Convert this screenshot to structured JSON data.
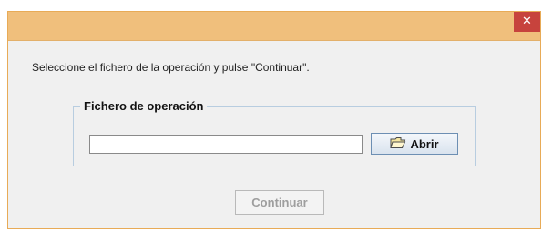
{
  "window": {
    "close_label": "✕"
  },
  "dialog": {
    "instruction": "Seleccione el fichero de la operación y pulse \"Continuar\".",
    "group_title": "Fichero de operación",
    "file_value": "",
    "open_label": "Abrir",
    "continue_label": "Continuar",
    "continue_enabled": false
  },
  "colors": {
    "titlebar": "#f0bf7c",
    "close_button": "#c7433d",
    "window_bg": "#f0f0f0",
    "group_border": "#b8cde0"
  },
  "icons": {
    "open_button": "folder-icon",
    "close_button": "close-icon"
  }
}
